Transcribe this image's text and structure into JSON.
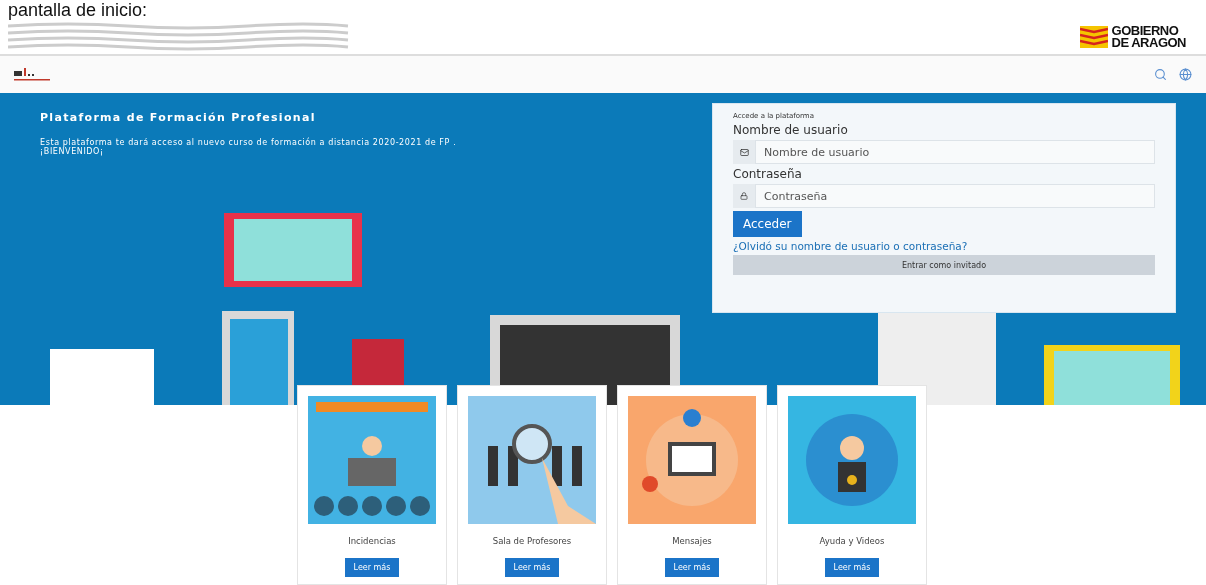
{
  "caption": "pantalla de inicio:",
  "header": {
    "government": [
      "GOBIERNO",
      "DE ARAGON"
    ]
  },
  "hero": {
    "title": "Plataforma de Formación Profesional",
    "lines": [
      "Esta plataforma te dará acceso al nuevo curso de formación a distancia 2020-2021 de FP .",
      "¡BIENVENIDO¡"
    ]
  },
  "login": {
    "heading": "Accede a la plataforma",
    "fields": [
      {
        "kind": "user",
        "label": "Nombre de usuario",
        "placeholder": "Nombre de usuario"
      },
      {
        "kind": "password",
        "label": "Contraseña",
        "placeholder": "Contraseña"
      }
    ],
    "submit": "Acceder",
    "forgot": "¿Olvidó su nombre de usuario o contraseña?",
    "guest": "Entrar como invitado"
  },
  "cards": [
    {
      "kind": "distance",
      "title": "Incidencias",
      "button": "Leer más"
    },
    {
      "kind": "search",
      "title": "Sala de Profesores",
      "button": "Leer más"
    },
    {
      "kind": "messages",
      "title": "Mensajes",
      "button": "Leer más"
    },
    {
      "kind": "help",
      "title": "Ayuda y Videos",
      "button": "Leer más"
    }
  ]
}
